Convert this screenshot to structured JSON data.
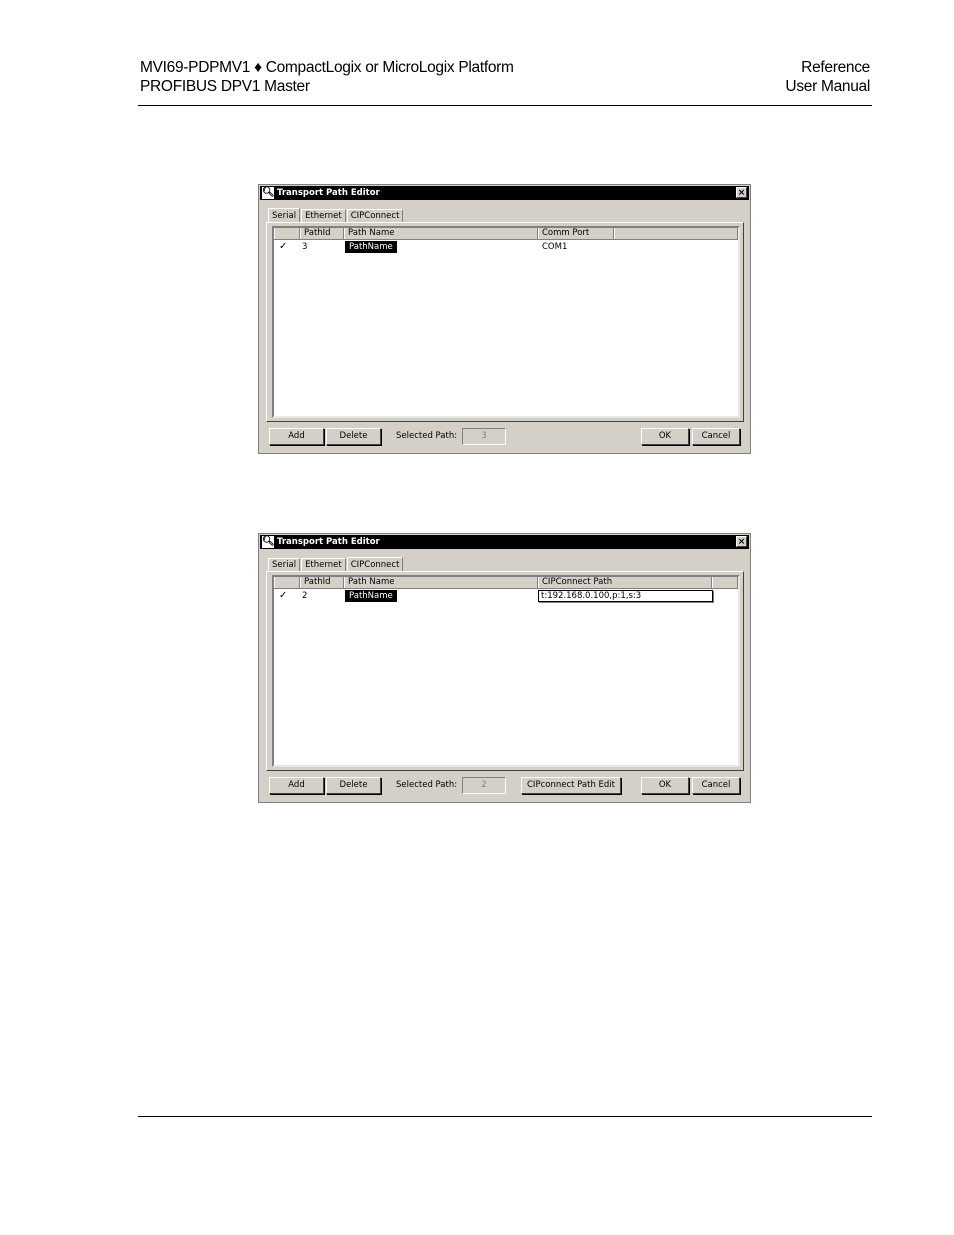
{
  "header": {
    "left_line1": "MVI69-PDPMV1 ♦ CompactLogix or MicroLogix Platform",
    "left_line2": "PROFIBUS DPV1 Master",
    "right_line1": "Reference",
    "right_line2": "User Manual"
  },
  "dialogs": [
    {
      "title": "Transport Path Editor",
      "close": "×",
      "tabs": [
        "Serial",
        "Ethernet",
        "CIPConnect"
      ],
      "active_tab": "Serial",
      "columns": [
        "",
        "PathId",
        "Path Name",
        "Comm Port",
        ""
      ],
      "row": {
        "check": "✓",
        "path_id": "3",
        "path_name": "PathName",
        "value": "COM1"
      },
      "buttons": {
        "add": "Add",
        "delete": "Delete",
        "ok": "OK",
        "cancel": "Cancel"
      },
      "selected_label": "Selected Path:",
      "selected_value": "3"
    },
    {
      "title": "Transport Path Editor",
      "close": "×",
      "tabs": [
        "Serial",
        "Ethernet",
        "CIPConnect"
      ],
      "active_tab": "CIPConnect",
      "columns": [
        "",
        "PathId",
        "Path Name",
        "CIPConnect Path",
        ""
      ],
      "row": {
        "check": "✓",
        "path_id": "2",
        "path_name": "PathName",
        "value": "t:192.168.0.100,p:1,s:3"
      },
      "buttons": {
        "add": "Add",
        "delete": "Delete",
        "cip_edit": "CIPconnect Path Edit",
        "ok": "OK",
        "cancel": "Cancel"
      },
      "selected_label": "Selected Path:",
      "selected_value": "2"
    }
  ]
}
